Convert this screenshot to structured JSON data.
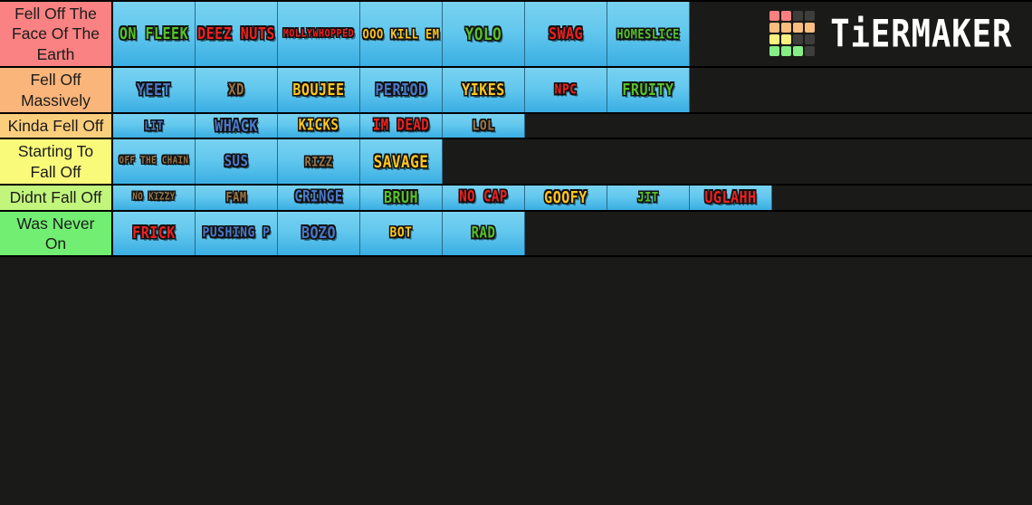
{
  "brand": {
    "name": "TiERMAKER",
    "logo_colors": [
      "#f98080",
      "#f98080",
      "#3d3d3b",
      "#3d3d3b",
      "#fabd80",
      "#fabd80",
      "#fabd80",
      "#fabd80",
      "#faf080",
      "#faf080",
      "#3d3d3b",
      "#3d3d3b",
      "#85ee85",
      "#85ee85",
      "#85ee85",
      "#3d3d3b"
    ]
  },
  "palette": {
    "cell_blue_top": "#79d2f0",
    "cell_blue_bottom": "#3aaee3",
    "background": "#1a1a18",
    "text_red": "#f01f1f",
    "text_green": "#56c12a",
    "text_blue": "#4a78c8",
    "text_yellow": "#ffc61e",
    "text_brown": "#9b7545"
  },
  "tiers": [
    {
      "label": "Fell Off The Face Of The Earth",
      "color": "#fa8282",
      "items": [
        {
          "text": "ON FLEEK",
          "color": "#56c12a",
          "size": 15
        },
        {
          "text": "DEEZ NUTS",
          "color": "#f01f1f",
          "size": 15
        },
        {
          "text": "MOLLYWHOPPED",
          "color": "#f01f1f",
          "size": 10
        },
        {
          "text": "OOO KILL EM",
          "color": "#ffc61e",
          "size": 12
        },
        {
          "text": "YOLO",
          "color": "#56c12a",
          "size": 16
        },
        {
          "text": "SWAG",
          "color": "#f01f1f",
          "size": 15
        },
        {
          "text": "HOMESLICE",
          "color": "#56c12a",
          "size": 12
        }
      ]
    },
    {
      "label": "Fell Off Massively",
      "color": "#fab57a",
      "items": [
        {
          "text": "YEET",
          "color": "#4a78c8",
          "size": 15
        },
        {
          "text": "XD",
          "color": "#9b7545",
          "size": 14
        },
        {
          "text": "BOUJEE",
          "color": "#ffc61e",
          "size": 15
        },
        {
          "text": "PERIOD",
          "color": "#4a78c8",
          "size": 15
        },
        {
          "text": "YIKES",
          "color": "#ffc61e",
          "size": 15
        },
        {
          "text": "NPC",
          "color": "#f01f1f",
          "size": 13
        },
        {
          "text": "FRUITY",
          "color": "#56c12a",
          "size": 15
        }
      ]
    },
    {
      "label": "Kinda Fell Off",
      "color": "#fbce7c",
      "items": [
        {
          "text": "LIT",
          "color": "#4a78c8",
          "size": 11
        },
        {
          "text": "WHACK",
          "color": "#4a78c8",
          "size": 15
        },
        {
          "text": "KICKS",
          "color": "#ffc61e",
          "size": 14
        },
        {
          "text": "IM DEAD",
          "color": "#f01f1f",
          "size": 14
        },
        {
          "text": "LOL",
          "color": "#9b7545",
          "size": 13
        }
      ]
    },
    {
      "label": "Starting To Fall Off",
      "color": "#fafa7a",
      "items": [
        {
          "text": "OFF THE CHAIN",
          "color": "#9b7545",
          "size": 9
        },
        {
          "text": "SUS",
          "color": "#4a78c8",
          "size": 14
        },
        {
          "text": "RIZZ",
          "color": "#9b7545",
          "size": 12
        },
        {
          "text": "SAVAGE",
          "color": "#ffc61e",
          "size": 16
        }
      ]
    },
    {
      "label": "Didnt Fall Off",
      "color": "#c2f57c",
      "items": [
        {
          "text": "NO KIZZY",
          "color": "#9b7545",
          "size": 9
        },
        {
          "text": "FAM",
          "color": "#9b7545",
          "size": 12
        },
        {
          "text": "CRINGE",
          "color": "#4a78c8",
          "size": 14
        },
        {
          "text": "BRUH",
          "color": "#56c12a",
          "size": 15
        },
        {
          "text": "NO CAP",
          "color": "#f01f1f",
          "size": 14
        },
        {
          "text": "GOOFY",
          "color": "#ffc61e",
          "size": 15
        },
        {
          "text": "JIT",
          "color": "#56c12a",
          "size": 12
        },
        {
          "text": "UGLAHH",
          "color": "#f01f1f",
          "size": 15
        }
      ]
    },
    {
      "label": "Was Never On",
      "color": "#72ee72",
      "items": [
        {
          "text": "FRICK",
          "color": "#f01f1f",
          "size": 15
        },
        {
          "text": "PUSHING P",
          "color": "#4a78c8",
          "size": 13
        },
        {
          "text": "BOZO",
          "color": "#4a78c8",
          "size": 15
        },
        {
          "text": "BOT",
          "color": "#ffc61e",
          "size": 13
        },
        {
          "text": "RAD",
          "color": "#56c12a",
          "size": 14
        }
      ]
    }
  ]
}
